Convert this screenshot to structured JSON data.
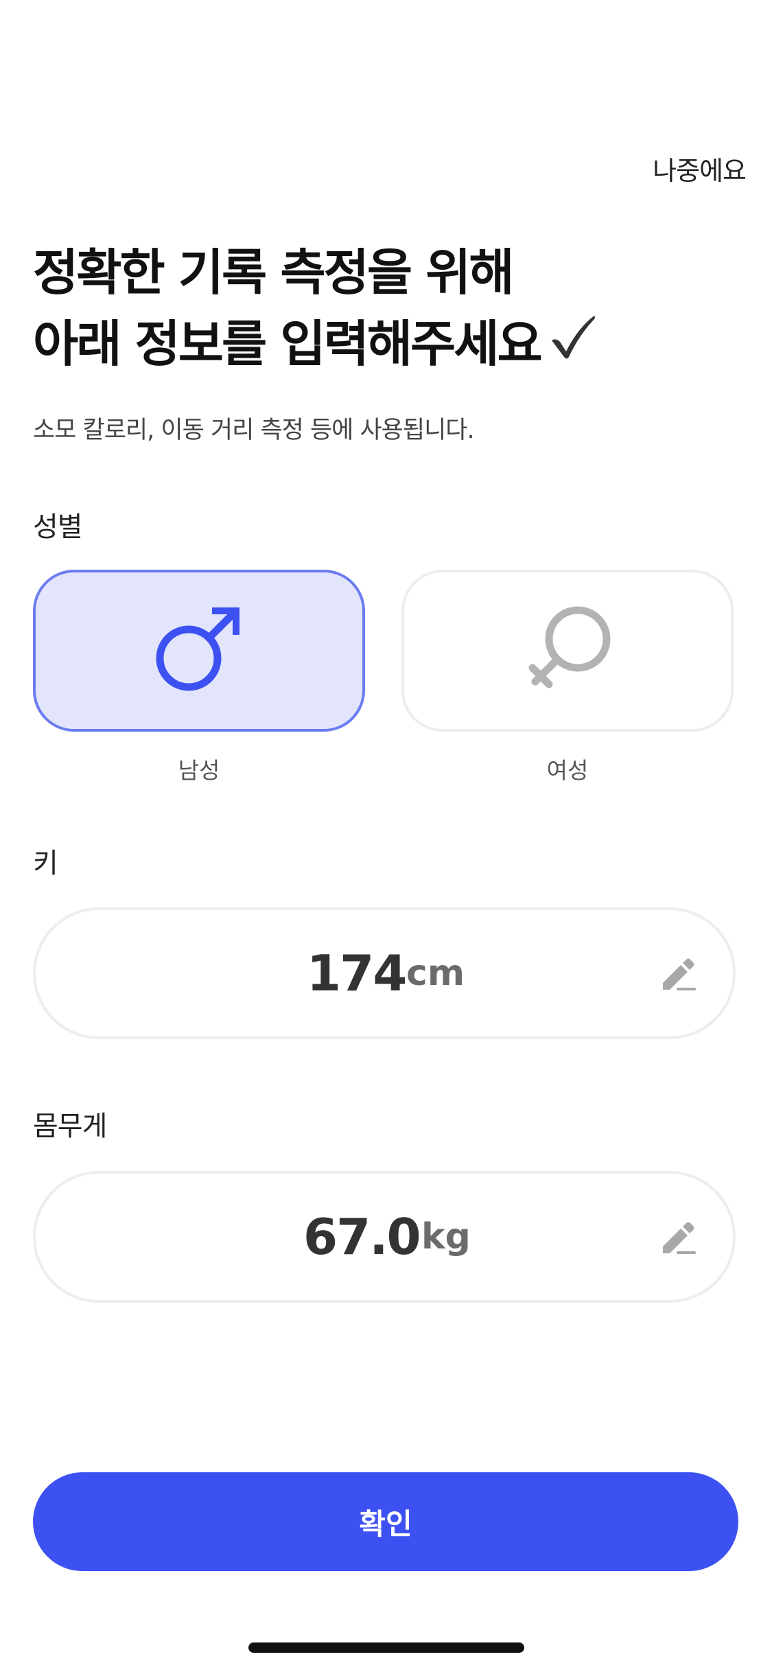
{
  "header": {
    "skip_label": "나중에요"
  },
  "intro": {
    "title_line1": "정확한 기록 측정을 위해",
    "title_line2": "아래 정보를 입력해주세요",
    "subtitle": "소모 칼로리, 이동 거리 측정 등에 사용됩니다."
  },
  "gender": {
    "label": "성별",
    "selected": "male",
    "options": [
      {
        "id": "male",
        "label": "남성",
        "icon": "male-symbol-icon"
      },
      {
        "id": "female",
        "label": "여성",
        "icon": "female-symbol-icon"
      }
    ]
  },
  "height": {
    "label": "키",
    "value": "174",
    "unit": "cm",
    "edit_icon": "pencil-icon"
  },
  "weight": {
    "label": "몸무게",
    "value": "67.0",
    "unit": "kg",
    "edit_icon": "pencil-icon"
  },
  "footer": {
    "confirm_label": "확인"
  },
  "colors": {
    "accent": "#3d51f2",
    "selected_bg": "#e2e5fb",
    "selected_border": "#6c7cf0",
    "inactive_icon": "#b3b3b3",
    "field_border": "#ececf1"
  }
}
